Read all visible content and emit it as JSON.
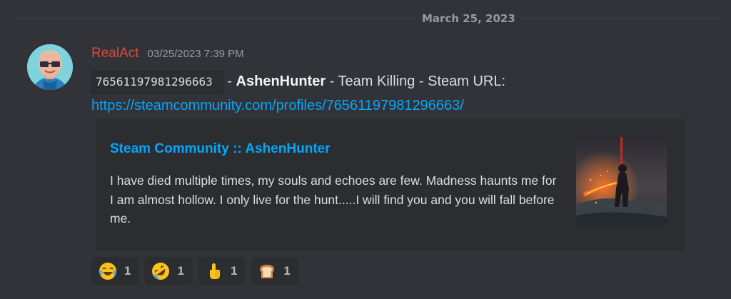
{
  "divider": {
    "date": "March 25, 2023"
  },
  "message": {
    "username": "RealAct",
    "timestamp": "03/25/2023 7:39 PM",
    "code": "76561197981296663",
    "sep1": " - ",
    "player": "AshenHunter",
    "reason_text": " - Team Killing - Steam URL:",
    "url": "https://steamcommunity.com/profiles/76561197981296663/"
  },
  "embed": {
    "title": "Steam Community :: AshenHunter",
    "description": "I have died multiple times, my souls and echoes are few. Madness haunts me for I am almost hollow. I only live for the hunt.....I will find you and you will fall before me."
  },
  "reactions": [
    {
      "emoji": "face-with-tears-of-joy-icon",
      "count": "1"
    },
    {
      "emoji": "rolling-on-floor-laughing-icon",
      "count": "1"
    },
    {
      "emoji": "pointing-up-hand-icon",
      "count": "1"
    },
    {
      "emoji": "bread-icon",
      "count": "1"
    }
  ],
  "colors": {
    "background": "#313338",
    "username": "#e0483d",
    "link": "#00a8fc",
    "embed_bg": "#2b2d31"
  }
}
